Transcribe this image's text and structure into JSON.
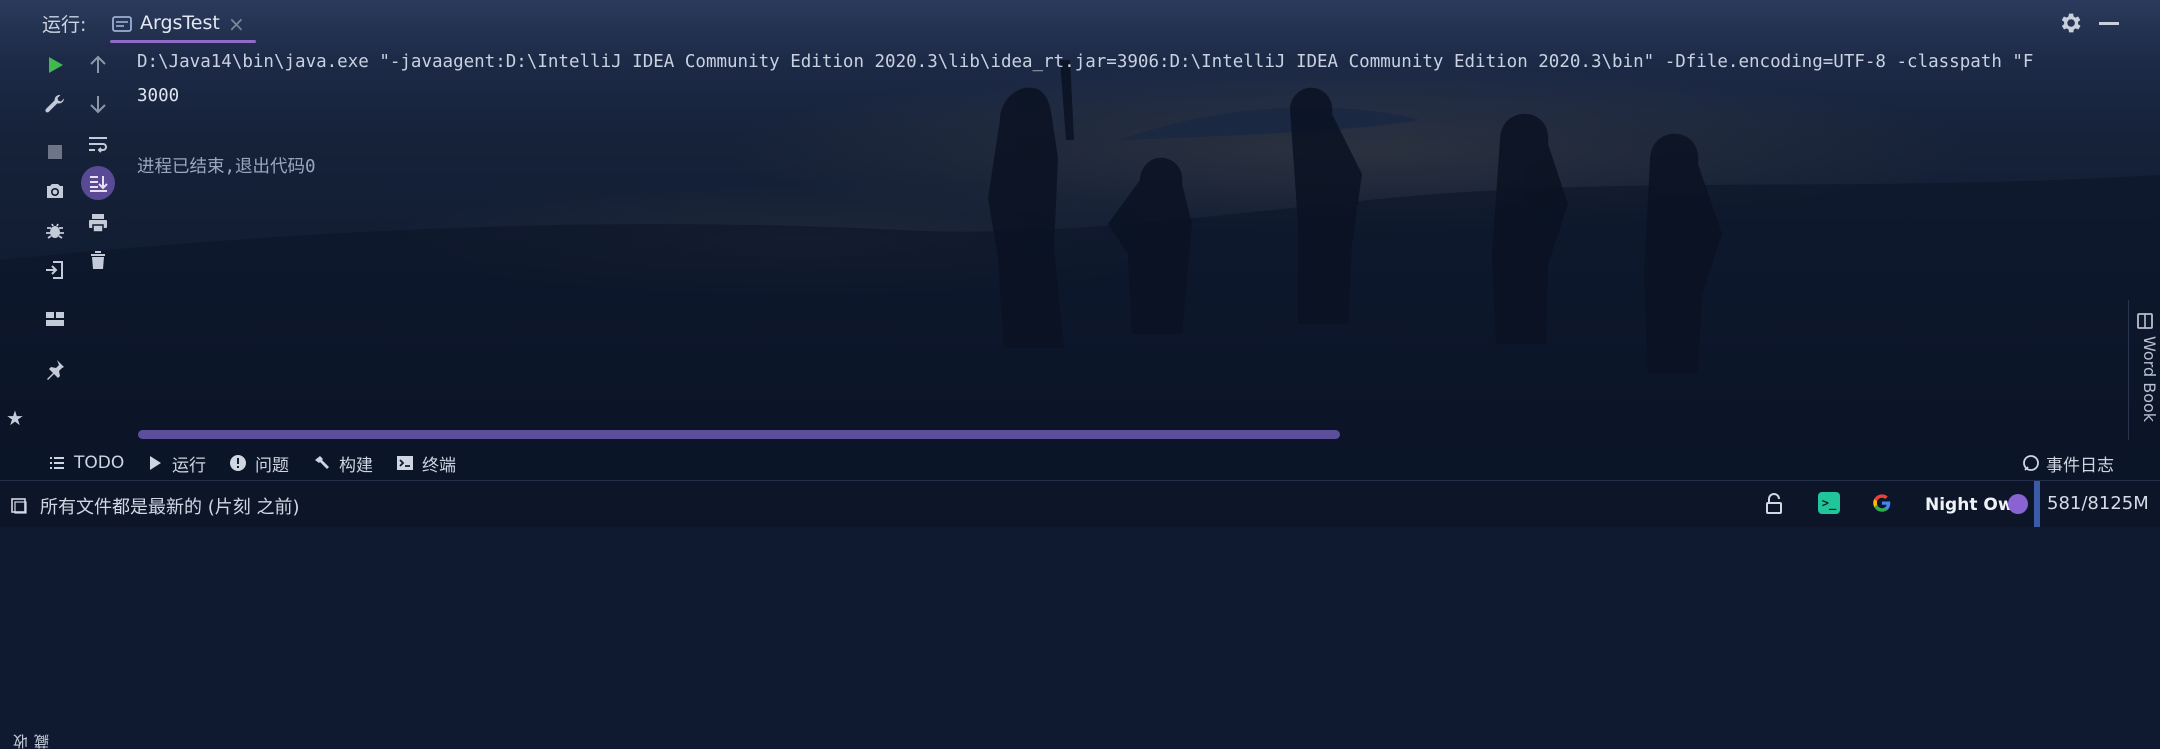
{
  "run_panel": {
    "label": "运行:",
    "tab": {
      "title": "ArgsTest",
      "close": "×"
    }
  },
  "console": {
    "command": "D:\\Java14\\bin\\java.exe \"-javaagent:D:\\IntelliJ IDEA Community Edition 2020.3\\lib\\idea_rt.jar=3906:D:\\IntelliJ IDEA Community Edition 2020.3\\bin\" -Dfile.encoding=UTF-8 -classpath \"F",
    "output": "3000",
    "exit_message": "进程已结束,退出代码0"
  },
  "side_panels": {
    "favorites": "收藏",
    "word_book": "Word Book"
  },
  "tool_windows": [
    {
      "label": "TODO",
      "icon": "list-icon"
    },
    {
      "label": "运行",
      "icon": "play-icon"
    },
    {
      "label": "问题",
      "icon": "info-icon"
    },
    {
      "label": "构建",
      "icon": "hammer-icon"
    },
    {
      "label": "终端",
      "icon": "terminal-icon"
    }
  ],
  "event_log": "事件日志",
  "status_bar": {
    "message": "所有文件都是最新的 (片刻 之前)",
    "theme": "Night Owl",
    "memory": "581/8125M"
  },
  "colors": {
    "accent": "#8f6ac8",
    "run_green": "#3fb950",
    "scrollbar": "#5b4e9b",
    "background": "#0f1a30"
  }
}
